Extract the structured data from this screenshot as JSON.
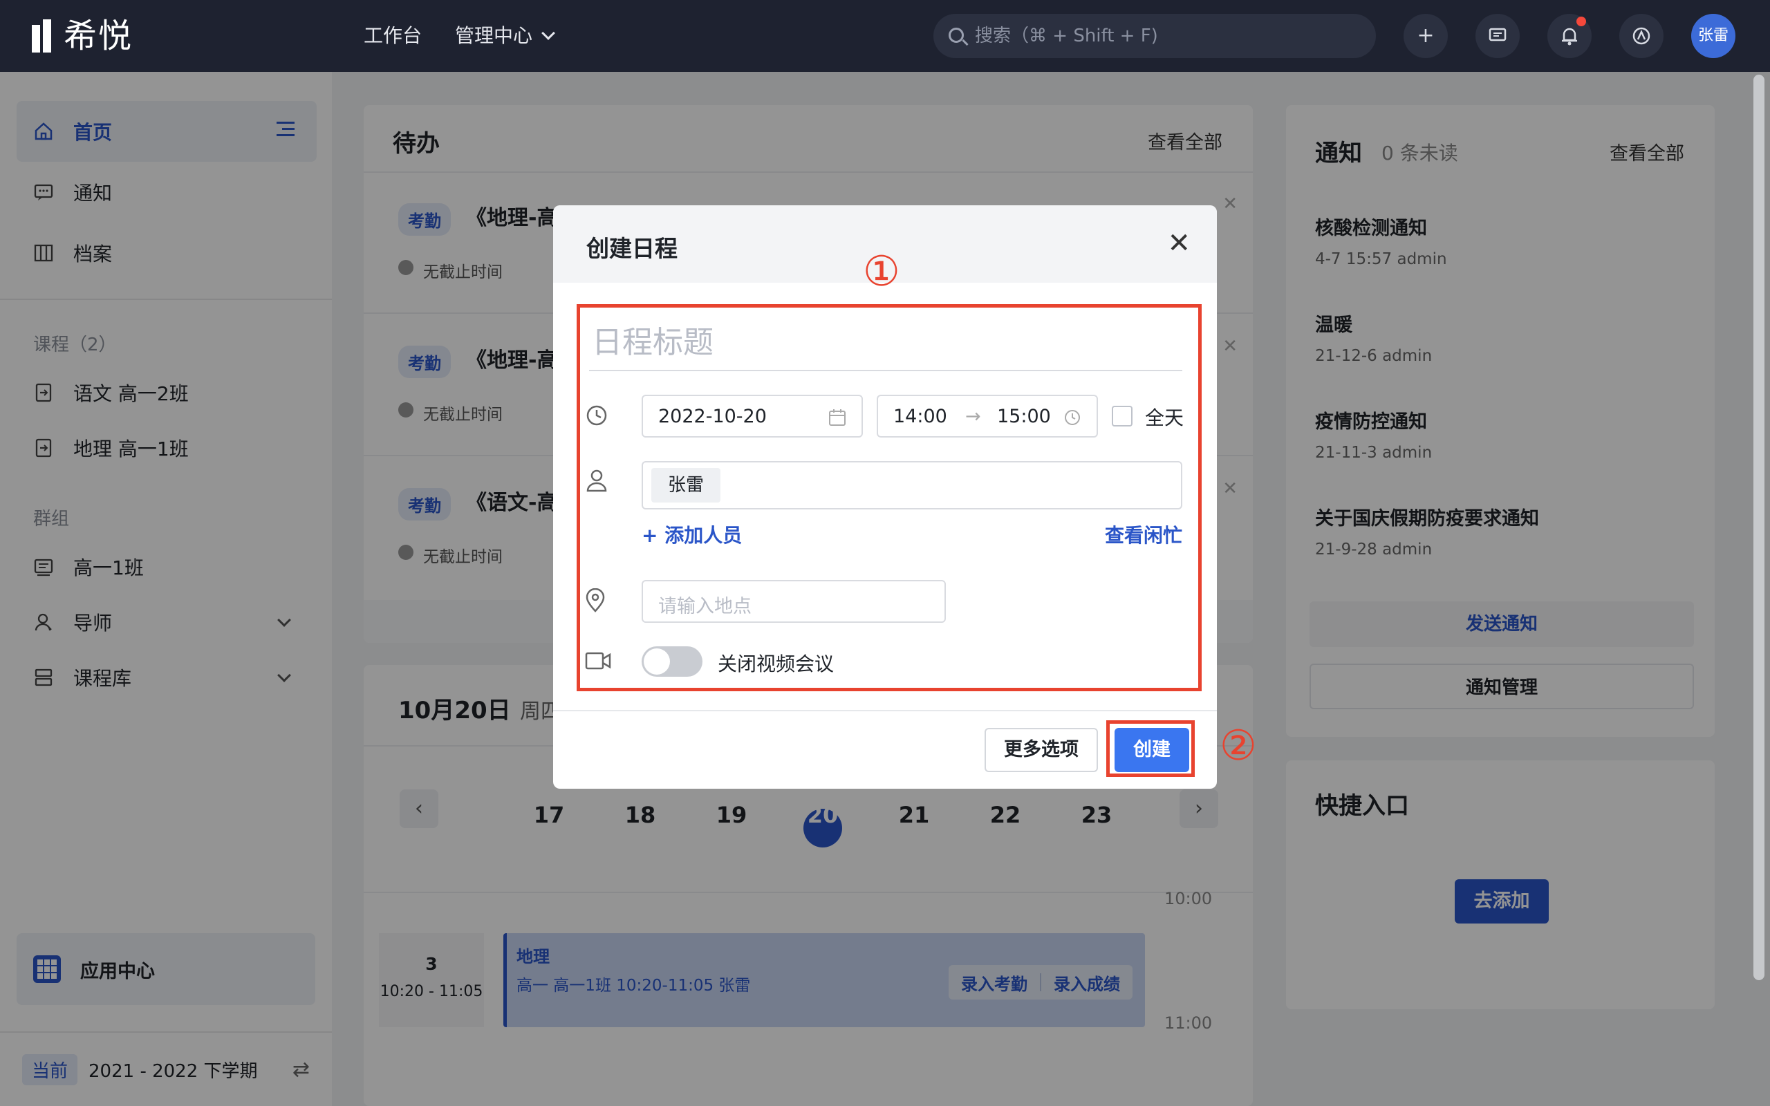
{
  "app": {
    "logo_text": "希悦"
  },
  "topnav": {
    "workbench": "工作台",
    "admin_center": "管理中心",
    "search_placeholder": "搜索（⌘ + Shift + F)",
    "user_name": "张雷"
  },
  "sidebar": {
    "home": "首页",
    "notice": "通知",
    "archive": "档案",
    "courses_section": "课程（2）",
    "course1": "语文 高一2班",
    "course2": "地理 高一1班",
    "groups_section": "群组",
    "group1": "高一1班",
    "mentor": "导师",
    "course_library": "课程库",
    "app_center": "应用中心",
    "term_badge": "当前",
    "term_name": "2021 - 2022 下学期"
  },
  "todo": {
    "title": "待办",
    "view_all": "查看全部",
    "items": [
      {
        "tag": "考勤",
        "title": "《地理-高",
        "sub": "无截止时间"
      },
      {
        "tag": "考勤",
        "title": "《地理-高",
        "sub": "无截止时间"
      },
      {
        "tag": "考勤",
        "title": "《语文-高",
        "sub": "无截止时间"
      }
    ]
  },
  "calendar": {
    "date_title": "10月20日",
    "weekday": "周四",
    "days": [
      "17",
      "18",
      "19",
      "20",
      "21",
      "22",
      "23"
    ],
    "time1": "10:00",
    "time2": "11:00",
    "period_num": "3",
    "period_time": "10:20 - 11:05",
    "event_title": "地理",
    "event_detail": "高一  高一1班  10:20-11:05  张雷",
    "event_action1": "录入考勤",
    "event_action2": "录入成绩"
  },
  "notices": {
    "title": "通知",
    "unread": "0 条未读",
    "view_all": "查看全部",
    "items": [
      {
        "title": "核酸检测通知",
        "meta": "4-7 15:57   admin"
      },
      {
        "title": "温暖",
        "meta": "21-12-6   admin"
      },
      {
        "title": "疫情防控通知",
        "meta": "21-11-3   admin"
      },
      {
        "title": "关于国庆假期防疫要求通知",
        "meta": "21-9-28   admin"
      }
    ],
    "send": "发送通知",
    "manage": "通知管理"
  },
  "quick": {
    "title": "快捷入口",
    "add": "去添加"
  },
  "modal": {
    "title": "创建日程",
    "title_placeholder": "日程标题",
    "date": "2022-10-20",
    "start_time": "14:00",
    "arrow": "→",
    "end_time": "15:00",
    "all_day": "全天",
    "attendee": "张雷",
    "add_person": "+ 添加人员",
    "check_busy": "查看闲忙",
    "location_placeholder": "请输入地点",
    "video_label": "关闭视频会议",
    "more_options": "更多选项",
    "create": "创建"
  },
  "annotations": {
    "step1": "①",
    "step2": "②"
  },
  "colors": {
    "accent": "#2a55c8",
    "annotation_red": "#e8432f",
    "topbar": "#1e2230"
  }
}
